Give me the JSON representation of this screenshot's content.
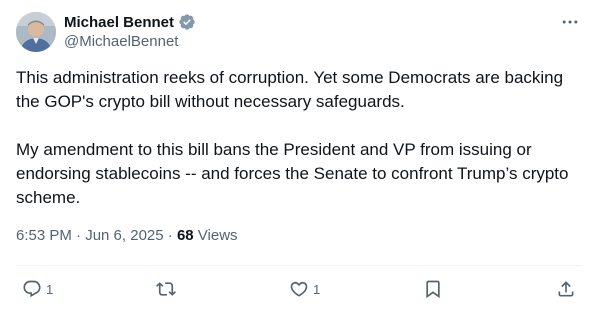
{
  "author": {
    "name": "Michael Bennet",
    "handle": "@MichaelBennet",
    "verified": true
  },
  "tweet": {
    "paragraphs": [
      "This administration reeks of corruption. Yet some Democrats are backing the GOP's crypto bill without necessary safeguards.",
      "My amendment to this bill bans the President and VP from issuing or endorsing stablecoins -- and forces the Senate to confront Trump’s crypto scheme."
    ],
    "timestamp": "6:53 PM · Jun 6, 2025",
    "separator": " · ",
    "views_count": "68",
    "views_label": " Views"
  },
  "actions": {
    "reply_count": "1",
    "retweet_count": "",
    "like_count": "1"
  },
  "icons": {
    "verified": "verified-badge-icon",
    "more": "more-icon",
    "reply": "reply-icon",
    "retweet": "retweet-icon",
    "like": "like-icon",
    "bookmark": "bookmark-icon",
    "share": "share-icon"
  },
  "colors": {
    "text": "#0f1419",
    "secondary": "#536471",
    "verified": "#829aab",
    "divider": "#eff3f4"
  }
}
